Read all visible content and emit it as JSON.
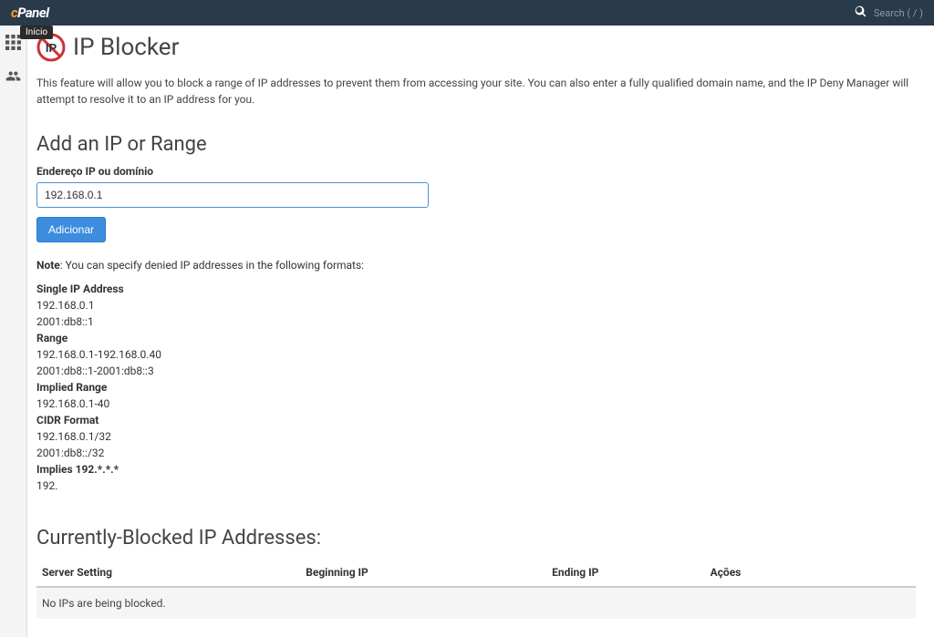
{
  "topbar": {
    "logo_prefix": "c",
    "logo_rest": "Panel",
    "search_placeholder": "Search ( / )"
  },
  "sidebar": {
    "tooltip": "Início"
  },
  "page": {
    "title": "IP Blocker",
    "description": "This feature will allow you to block a range of IP addresses to prevent them from accessing your site. You can also enter a fully qualified domain name, and the IP Deny Manager will attempt to resolve it to an IP address for you."
  },
  "add_section": {
    "heading": "Add an IP or Range",
    "field_label": "Endereço IP ou domínio",
    "input_value": "192.168.0.1",
    "button_label": "Adicionar",
    "note_strong": "Note",
    "note_rest": ": You can specify denied IP addresses in the following formats:"
  },
  "formats": {
    "single_title": "Single IP Address",
    "single_ex1": "192.168.0.1",
    "single_ex2": "2001:db8::1",
    "range_title": "Range",
    "range_ex1": "192.168.0.1-192.168.0.40",
    "range_ex2": "2001:db8::1-2001:db8::3",
    "implied_title": "Implied Range",
    "implied_ex1": "192.168.0.1-40",
    "cidr_title": "CIDR Format",
    "cidr_ex1": "192.168.0.1/32",
    "cidr_ex2": "2001:db8::/32",
    "implies_title": "Implies 192.*.*.*",
    "implies_ex1": "192."
  },
  "blocked_section": {
    "heading": "Currently-Blocked IP Addresses:",
    "col_server": "Server Setting",
    "col_begin": "Beginning IP",
    "col_end": "Ending IP",
    "col_actions": "Ações",
    "empty_msg": "No IPs are being blocked."
  }
}
